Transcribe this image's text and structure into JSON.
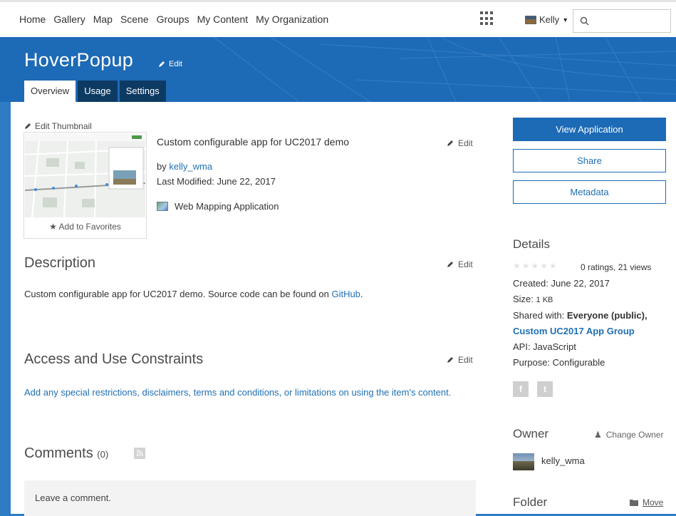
{
  "nav": {
    "links": [
      "Home",
      "Gallery",
      "Map",
      "Scene",
      "Groups",
      "My Content",
      "My Organization"
    ],
    "user_name": "Kelly"
  },
  "item": {
    "title": "HoverPopup",
    "title_edit": "Edit",
    "tabs": [
      "Overview",
      "Usage",
      "Settings"
    ],
    "active_tab": "Overview",
    "edit_thumbnail": "Edit Thumbnail",
    "add_favorites": "Add to Favorites",
    "summary": "Custom configurable app for UC2017 demo",
    "by_prefix": "by",
    "owner": "kelly_wma",
    "last_modified": "Last Modified: June 22, 2017",
    "type": "Web Mapping Application",
    "edit_label": "Edit"
  },
  "description": {
    "heading": "Description",
    "text": "Custom configurable app for UC2017 demo. Source code can be found on",
    "link": "GitHub",
    "after_link": "."
  },
  "constraints": {
    "heading": "Access and Use Constraints",
    "text": "Add any special restrictions, disclaimers, terms and conditions, or limitations on using the item's content."
  },
  "comments": {
    "heading": "Comments",
    "count": "(0)",
    "placeholder": "Leave a comment."
  },
  "sidebar": {
    "view_application": "View Application",
    "share": "Share",
    "metadata": "Metadata",
    "details_heading": "Details",
    "ratings": "0 ratings, 21 views",
    "created": "Created: June 22, 2017",
    "size_label": "Size: ",
    "size_value": "1 KB",
    "shared_label": "Shared with: ",
    "shared_value": "Everyone (public),",
    "group": "Custom UC2017 App Group",
    "api": "API: JavaScript",
    "purpose": "Purpose: Configurable",
    "owner_heading": "Owner",
    "change_owner": "Change Owner",
    "owner_name": "kelly_wma",
    "folder_heading": "Folder",
    "move": "Move"
  },
  "colors": {
    "banner": "#1d6ab6",
    "link": "#1f6fb3",
    "tab_inactive": "#0d3a63"
  }
}
